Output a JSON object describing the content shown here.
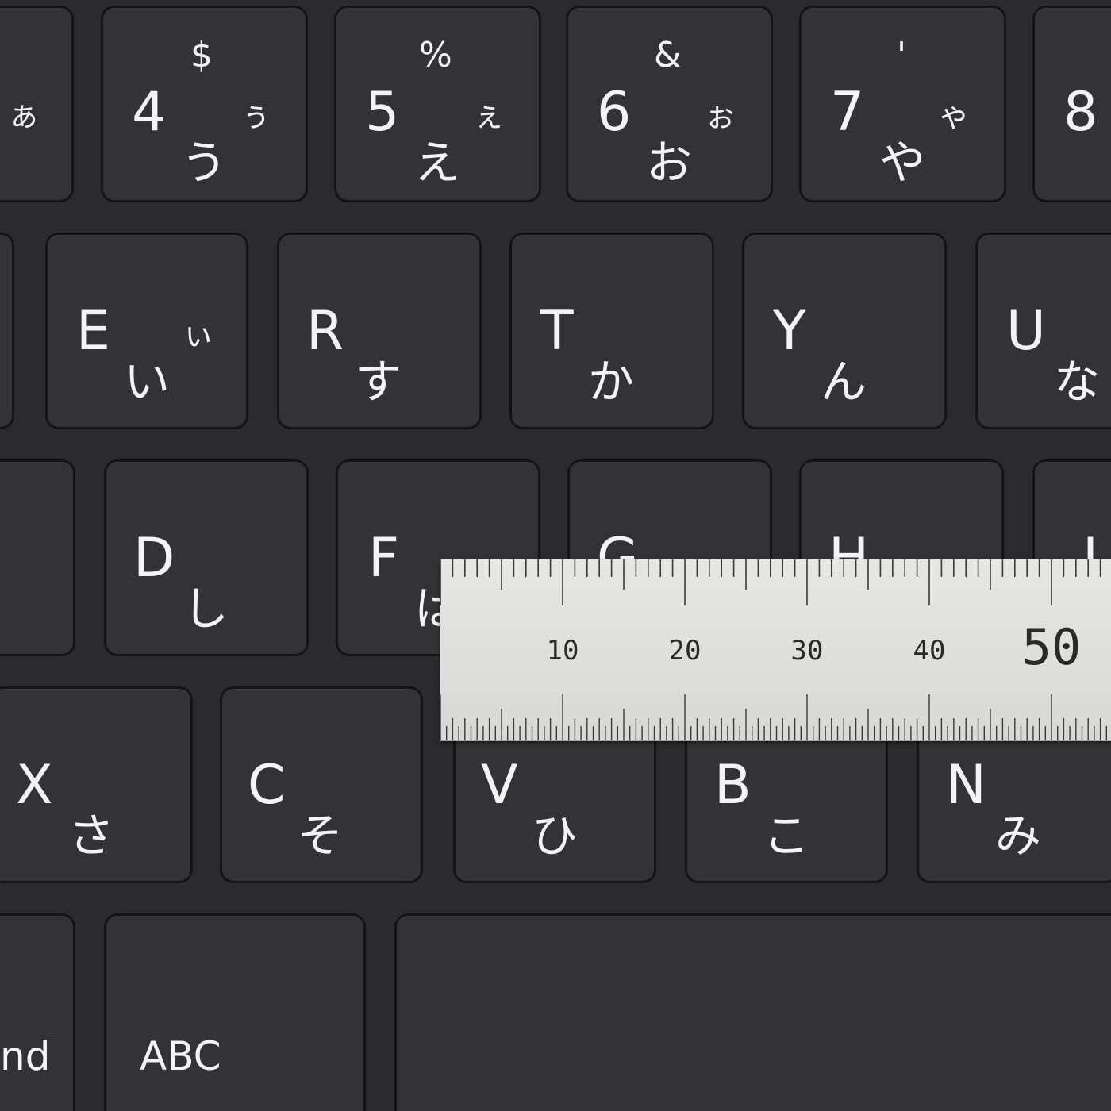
{
  "keyboard": {
    "row1": [
      {
        "id": "a",
        "kana_small": "ぁ"
      },
      {
        "id": "4",
        "main": "4",
        "symbol": "$",
        "kana_small": "ぅ",
        "kana": "う"
      },
      {
        "id": "5",
        "main": "5",
        "symbol": "%",
        "kana_small": "ぇ",
        "kana": "え"
      },
      {
        "id": "6",
        "main": "6",
        "symbol": "&",
        "kana_small": "ぉ",
        "kana": "お"
      },
      {
        "id": "7",
        "main": "7",
        "symbol": "'",
        "kana_small": "ゃ",
        "kana": "や"
      },
      {
        "id": "8",
        "main": "8"
      }
    ],
    "row2": [
      {
        "id": "e",
        "main": "E",
        "kana_small": "ぃ",
        "kana": "い"
      },
      {
        "id": "r",
        "main": "R",
        "kana": "す"
      },
      {
        "id": "t",
        "main": "T",
        "kana": "か"
      },
      {
        "id": "y",
        "main": "Y",
        "kana": "ん"
      },
      {
        "id": "u",
        "main": "U",
        "kana": "な"
      }
    ],
    "row3": [
      {
        "id": "d",
        "main": "D",
        "kana": "し"
      },
      {
        "id": "f",
        "main": "F",
        "kana": "は"
      },
      {
        "id": "g",
        "main": "G"
      },
      {
        "id": "h",
        "main": "H"
      },
      {
        "id": "j",
        "main": "J"
      }
    ],
    "row4": [
      {
        "id": "x",
        "main": "X",
        "kana": "さ"
      },
      {
        "id": "c",
        "main": "C",
        "kana": "そ"
      },
      {
        "id": "v",
        "main": "V",
        "kana": "ひ"
      },
      {
        "id": "b",
        "main": "B",
        "kana": "こ"
      },
      {
        "id": "n",
        "main": "N",
        "kana": "み"
      }
    ],
    "row5": [
      {
        "id": "command",
        "main": "nd"
      },
      {
        "id": "abc",
        "main": "ABC"
      },
      {
        "id": "space",
        "main": ""
      }
    ]
  },
  "ruler": {
    "labels": [
      "10",
      "20",
      "30",
      "40",
      "50"
    ],
    "colors": {
      "body": "#dedede",
      "ticks": "#3a3a3a"
    }
  }
}
